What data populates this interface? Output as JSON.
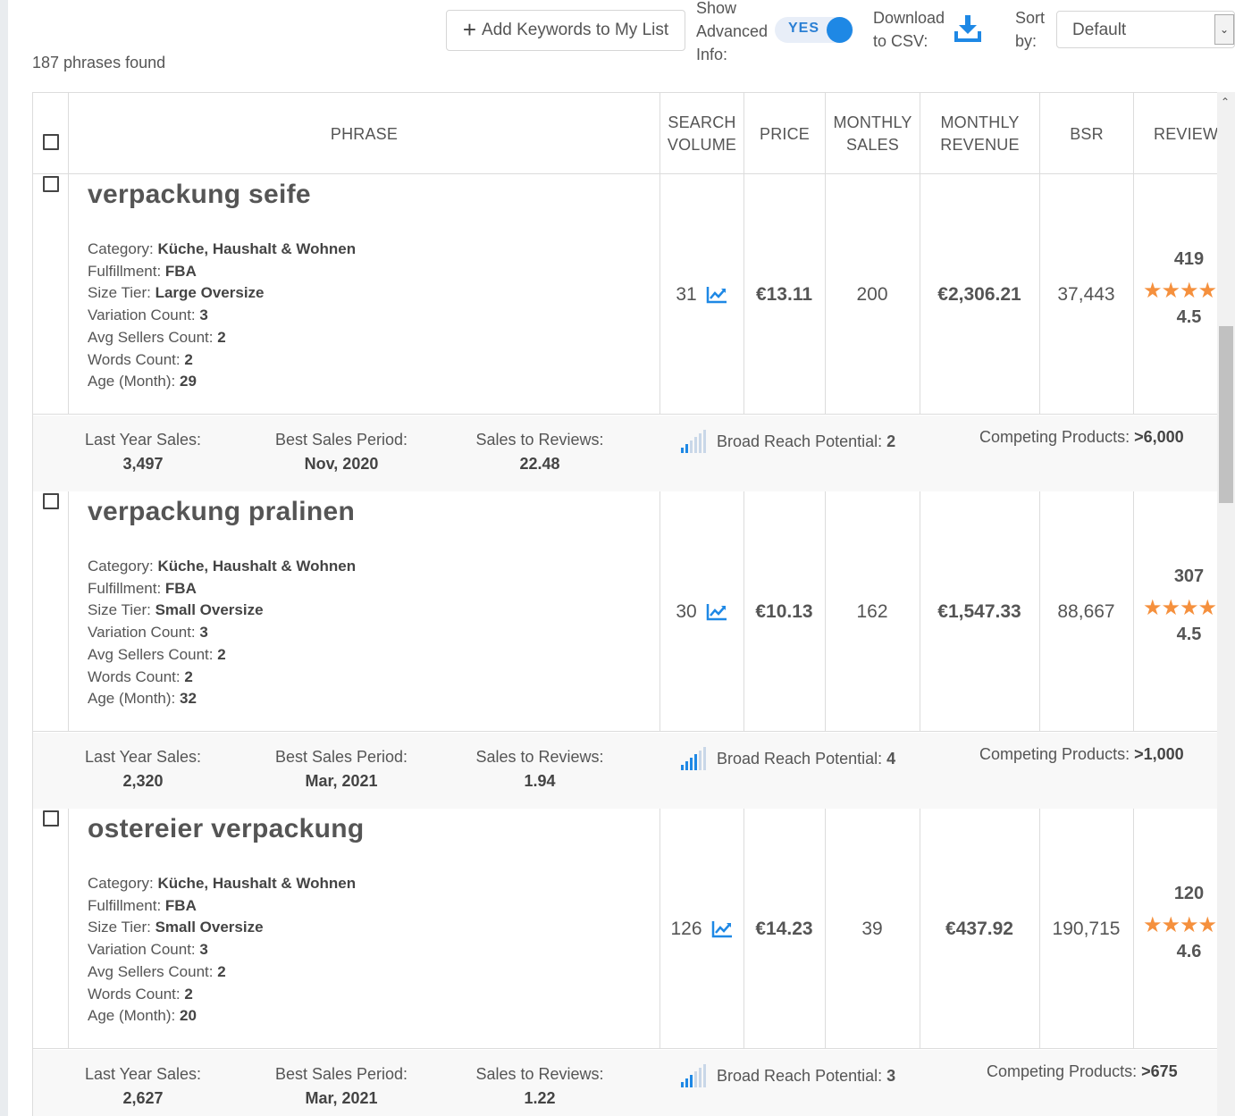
{
  "toolbar": {
    "phrases_found": "187 phrases found",
    "add_keywords_label": "Add Keywords to My List",
    "advanced_label_1": "Show",
    "advanced_label_2": "Advanced",
    "advanced_label_3": "Info:",
    "advanced_toggle_value": "YES",
    "download_label_1": "Download",
    "download_label_2": "to CSV:",
    "sort_label_1": "Sort",
    "sort_label_2": "by:",
    "sort_value": "Default"
  },
  "columns": {
    "phrase": "PHRASE",
    "search_volume_1": "SEARCH",
    "search_volume_2": "VOLUME",
    "price": "PRICE",
    "monthly_sales_1": "MONTHLY",
    "monthly_sales_2": "SALES",
    "monthly_revenue_1": "MONTHLY",
    "monthly_revenue_2": "REVENUE",
    "bsr": "BSR",
    "reviews": "REVIEWS"
  },
  "labels": {
    "category": "Category:",
    "fulfillment": "Fulfillment:",
    "size_tier": "Size Tier:",
    "variation_count": "Variation Count:",
    "avg_sellers_count": "Avg Sellers Count:",
    "words_count": "Words Count:",
    "age_month": "Age (Month):",
    "last_year_sales": "Last Year Sales:",
    "best_sales_period": "Best Sales Period:",
    "sales_to_reviews": "Sales to Reviews:",
    "broad_reach_potential": "Broad Reach Potential:",
    "competing_products": "Competing Products:"
  },
  "rows": [
    {
      "phrase": "verpackung seife",
      "category": "Küche, Haushalt & Wohnen",
      "fulfillment": "FBA",
      "size_tier": "Large Oversize",
      "variation_count": "3",
      "avg_sellers_count": "2",
      "words_count": "2",
      "age_month": "29",
      "search_volume": "31",
      "price": "€13.11",
      "monthly_sales": "200",
      "monthly_revenue": "€2,306.21",
      "bsr": "37,443",
      "reviews_count": "419",
      "stars": "★★★★★",
      "rating": "4.5",
      "last_year_sales": "3,497",
      "best_sales_period": "Nov, 2020",
      "sales_to_reviews": "22.48",
      "broad_reach_potential": "2",
      "competing_products": ">6,000"
    },
    {
      "phrase": "verpackung pralinen",
      "category": "Küche, Haushalt & Wohnen",
      "fulfillment": "FBA",
      "size_tier": "Small Oversize",
      "variation_count": "3",
      "avg_sellers_count": "2",
      "words_count": "2",
      "age_month": "32",
      "search_volume": "30",
      "price": "€10.13",
      "monthly_sales": "162",
      "monthly_revenue": "€1,547.33",
      "bsr": "88,667",
      "reviews_count": "307",
      "stars": "★★★★★",
      "rating": "4.5",
      "last_year_sales": "2,320",
      "best_sales_period": "Mar, 2021",
      "sales_to_reviews": "1.94",
      "broad_reach_potential": "4",
      "competing_products": ">1,000"
    },
    {
      "phrase": "ostereier verpackung",
      "category": "Küche, Haushalt & Wohnen",
      "fulfillment": "FBA",
      "size_tier": "Small Oversize",
      "variation_count": "3",
      "avg_sellers_count": "2",
      "words_count": "2",
      "age_month": "20",
      "search_volume": "126",
      "price": "€14.23",
      "monthly_sales": "39",
      "monthly_revenue": "€437.92",
      "bsr": "190,715",
      "reviews_count": "120",
      "stars": "★★★★★",
      "rating": "4.6",
      "last_year_sales": "2,627",
      "best_sales_period": "Mar, 2021",
      "sales_to_reviews": "1.22",
      "broad_reach_potential": "3",
      "competing_products": ">675"
    }
  ],
  "colors": {
    "accent_blue": "#1e88e5",
    "star_orange": "#f5903d",
    "text_gray": "#555555"
  },
  "icons": {
    "add": "plus-icon",
    "download": "download-icon",
    "trend": "trend-chart-icon",
    "reach": "signal-bars-icon",
    "sort_arrow": "chevron-down-icon",
    "scroll_up": "chevron-up-icon"
  }
}
